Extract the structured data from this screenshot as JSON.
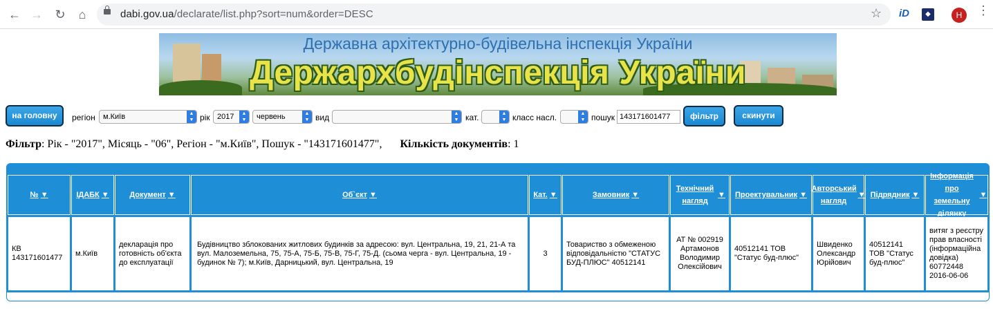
{
  "browser": {
    "url_host": "dabi.gov.ua",
    "url_path": "/declarate/list.php?sort=num&order=DESC",
    "avatar_letter": "H",
    "ext1_label": "iD",
    "icons": [
      "back-arrow-icon",
      "forward-arrow-icon",
      "reload-icon",
      "home-icon",
      "lock-icon",
      "star-icon",
      "menu-icon"
    ]
  },
  "banner": {
    "line1": "Державна архітектурно-будівельна інспекція України",
    "line2": "Держархбудінспекція України"
  },
  "controls": {
    "home_button": "на головну",
    "region_label": "регіон",
    "region_value": "м.Київ",
    "year_label": "рік",
    "year_value": "2017",
    "month_value": "червень",
    "type_label": "вид",
    "type_value": "",
    "cat_label": "кат.",
    "cat_value": "",
    "class_label": "класс насл.",
    "class_value": "",
    "search_label": "пошук",
    "search_value": "143171601477",
    "filter_button": "фільтр",
    "reset_button": "скинути"
  },
  "filter_summary": {
    "filter_label": "Фільтр",
    "filter_text": ": Рік - \"2017\", Місяць - \"06\", Регіон - \"м.Київ\", Пошук - \"143171601477\",",
    "count_label": "Кількість документів",
    "count_value": ": 1"
  },
  "table": {
    "headers": [
      "№",
      "ІДАБК",
      "Документ",
      "Об`єкт",
      "Кат.",
      "Замовник",
      "Технічний нагляд",
      "Проектувальник",
      "Авторський нагляд",
      "Підрядник",
      "Інформація про земельну ділянку"
    ],
    "row": {
      "num": "КВ 143171601477",
      "idabk": "м.Київ",
      "document": "декларація про готовність об'єкта до експлуатації",
      "object": "Будівництво зблокованих житлових будинків за адресою: вул. Центральна, 19, 21, 21-А та вул. Малоземельна, 75, 75-А, 75-Б, 75-В, 75-Г, 75-Д. (сьома черга - вул. Центральна, 19 - будинок № 7); м.Київ, Дарницький, вул. Центральна, 19",
      "cat": "3",
      "customer": "Товариство з обмеженою відповідальністю \"СТАТУС БУД-ПЛЮС\" 40512141",
      "tech_supervision": "АТ № 002919 Артамонов Володимир Олексійович",
      "designer": "40512141 ТОВ \"Статус буд-плюс\"",
      "author_supervision": "Швиденко Олександр Юрійович",
      "contractor": "40512141 ТОВ \"Статус буд-плюс\"",
      "land_info": "витяг з реєстру прав власності (інформаційна довідка) 60772448 2016-06-06"
    }
  },
  "colors": {
    "accent": "#1e8fd7",
    "button_border": "#0d2b45",
    "banner_text": "#e9e34a"
  }
}
